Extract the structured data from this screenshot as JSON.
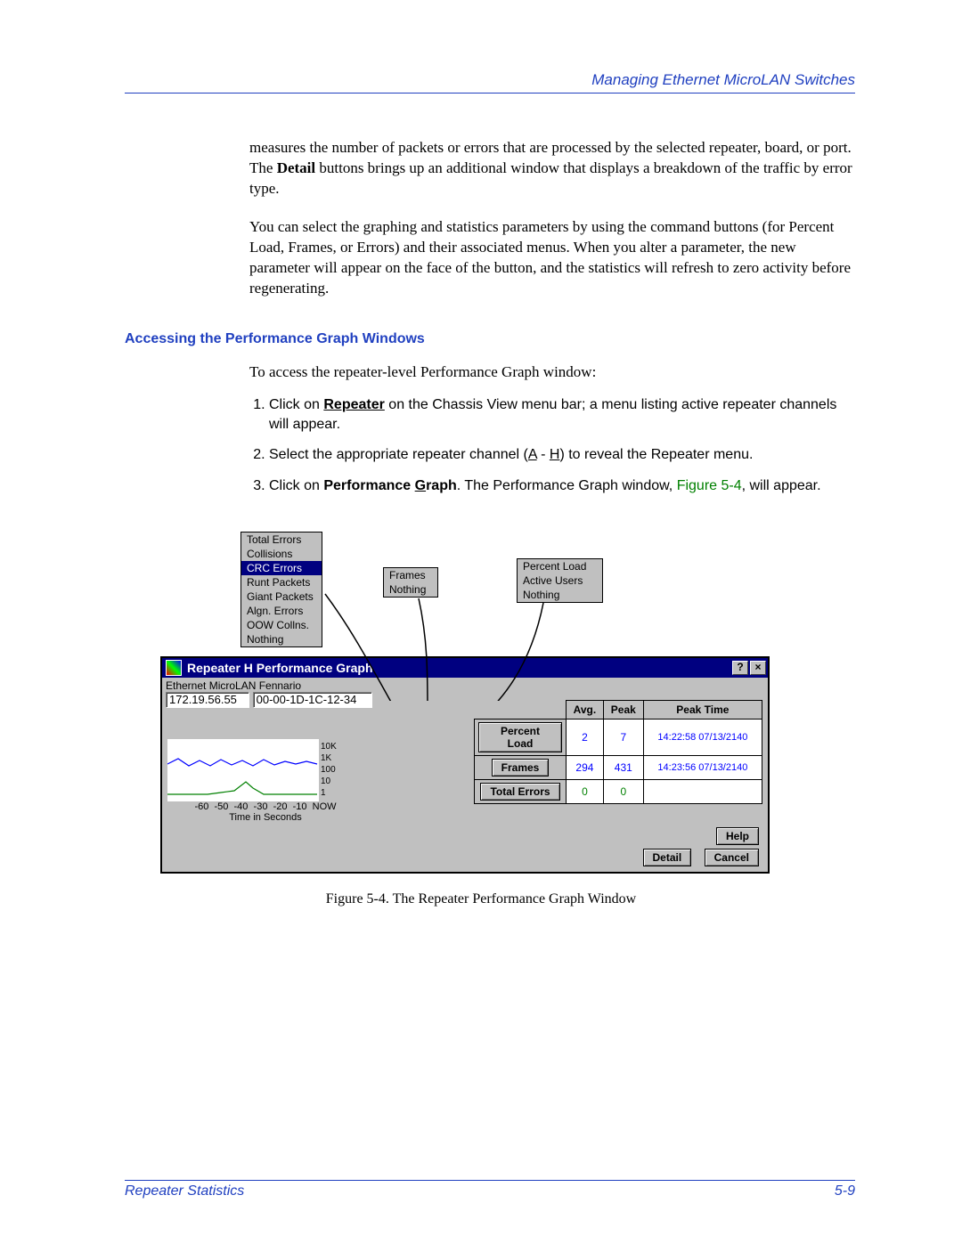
{
  "header": {
    "title": "Managing Ethernet MicroLAN Switches"
  },
  "para1_pre": "measures the number of packets or errors that are processed by the selected repeater, board, or port. The ",
  "para1_bold": "Detail",
  "para1_post": " buttons brings up an additional window that displays a breakdown of the traffic by error type.",
  "para2": "You can select the graphing and statistics parameters by using the command buttons (for Percent Load, Frames, or Errors) and their associated menus. When you alter a parameter, the new parameter will appear on the face of the button, and the statistics will refresh to zero activity before regenerating.",
  "section_head": "Accessing the Performance Graph Windows",
  "intro": "To access the repeater-level Performance Graph window:",
  "step1_pre": "Click on ",
  "step1_bold": "Repeater",
  "step1_post": " on the Chassis View menu bar; a menu listing active repeater channels will appear.",
  "step2_pre": "Select the appropriate repeater channel (",
  "step2_a": "A",
  "step2_mid": " - ",
  "step2_h": "H",
  "step2_post": ") to reveal the Repeater menu.",
  "step3_pre": "Click on ",
  "step3_bold_pre": "Performance ",
  "step3_bold_u": "G",
  "step3_bold_post": "raph",
  "step3_mid": ". The Performance Graph window, ",
  "step3_link": "Figure 5-4",
  "step3_post": ", will appear.",
  "menu1": [
    "Total Errors",
    "Collisions",
    "CRC Errors",
    "Runt Packets",
    "Giant Packets",
    "Algn. Errors",
    "OOW Collns.",
    "Nothing"
  ],
  "menu1_selected_index": 2,
  "menu2": [
    "Frames",
    "Nothing"
  ],
  "menu3": [
    "Percent Load",
    "Active Users",
    "Nothing"
  ],
  "win": {
    "title": "Repeater H Performance Graph",
    "help_glyph": "?",
    "close_glyph": "×",
    "device_label": "Ethernet MicroLAN Fennario",
    "ip": "172.19.56.55",
    "mac": "00-00-1D-1C-12-34",
    "headers": {
      "avg": "Avg.",
      "peak": "Peak",
      "peaktime": "Peak Time"
    },
    "rows": [
      {
        "label": "Percent Load",
        "avg": "2",
        "peak": "7",
        "time": "14:22:58 07/13/2140"
      },
      {
        "label": "Frames",
        "avg": "294",
        "peak": "431",
        "time": "14:23:56 07/13/2140"
      },
      {
        "label": "Total Errors",
        "avg": "0",
        "peak": "0",
        "time": ""
      }
    ],
    "yticks": [
      "10K",
      "1K",
      "100",
      "10",
      "1"
    ],
    "xticks": [
      "-60",
      "-50",
      "-40",
      "-30",
      "-20",
      "-10",
      "NOW"
    ],
    "xlabel": "Time in Seconds",
    "buttons": {
      "help": "Help",
      "detail": "Detail",
      "cancel": "Cancel"
    }
  },
  "figcaption": "Figure 5-4. The Repeater Performance Graph Window",
  "footer": {
    "left": "Repeater Statistics",
    "right": "5-9"
  },
  "chart_data": {
    "type": "line",
    "title": "Repeater H Performance Graph",
    "xlabel": "Time in Seconds",
    "ylabel": "",
    "x_ticks": [
      -60,
      -50,
      -40,
      -30,
      -20,
      -10,
      0
    ],
    "y_ticks_log": [
      1,
      10,
      100,
      1000,
      10000
    ],
    "series": [
      {
        "name": "Frames (blue)",
        "x": [
          -60,
          -55,
          -50,
          -45,
          -40,
          -35,
          -30,
          -25,
          -20,
          -15,
          -10,
          -5,
          0
        ],
        "y": [
          280,
          340,
          270,
          320,
          260,
          330,
          270,
          330,
          260,
          320,
          270,
          310,
          290
        ]
      },
      {
        "name": "Total Errors (green)",
        "x": [
          -60,
          -55,
          -50,
          -45,
          -40,
          -35,
          -30,
          -25,
          -20,
          -15,
          -10,
          -5,
          0
        ],
        "y": [
          1,
          1,
          1,
          1,
          1,
          1,
          2,
          4,
          2,
          1,
          1,
          1,
          1
        ]
      }
    ]
  }
}
